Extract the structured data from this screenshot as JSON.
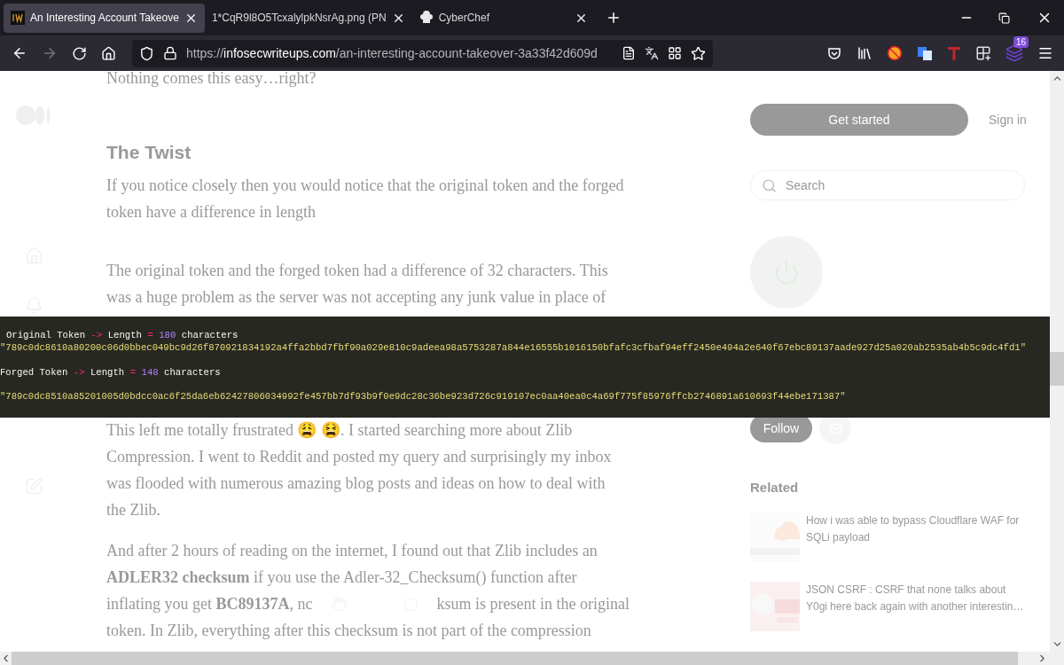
{
  "browser": {
    "tabs": [
      {
        "title": "An Interesting Account Takeove",
        "selected": true
      },
      {
        "title": "1*CqR9l8O5TcxalylpkNsrAg.png (PN",
        "selected": false
      },
      {
        "title": "CyberChef",
        "selected": false
      }
    ],
    "back": {
      "disabled": false
    },
    "forward": {
      "disabled": true
    },
    "address": {
      "scheme": "https://",
      "host": "infosecwriteups.com",
      "path": "/an-interesting-account-takeover-3a33f42d609d"
    },
    "extension_badge": "16"
  },
  "article": {
    "paragraphs": [
      {
        "kind": "text",
        "lines": [
          {
            "text": "Nothing comes this easy…right?"
          }
        ]
      },
      {
        "kind": "heading",
        "lines": [
          {
            "text": "The Twist"
          }
        ]
      },
      {
        "kind": "text",
        "lines": [
          {
            "text": "If you notice closely then you would notice that the original token and the forged"
          },
          {
            "text": "token have a difference in length"
          }
        ]
      },
      {
        "kind": "text",
        "lines": [
          {
            "text": "The original token and the forged token had a difference of 32 characters. This"
          },
          {
            "text": "was a huge problem as the server was not accepting any junk value in place of"
          }
        ]
      },
      {
        "kind": "text",
        "lines": [
          {
            "text": "This left me totally frustrated 😩 😫. I started searching more about Zlib"
          },
          {
            "text": "Compression. I went to Reddit and posted my query and surprisingly my inbox"
          },
          {
            "text": "was flooded with numerous amazing blog posts and ideas on how to deal with"
          },
          {
            "text": "the Zlib."
          }
        ]
      },
      {
        "kind": "text",
        "lines": [
          {
            "text": "And after 2 hours of reading on the internet, I found out that Zlib includes an"
          },
          {
            "text": "**ADLER32 checksum** if you use the Adler-32_Checksum() function after"
          },
          {
            "text": "inflating you get **BC89137A**, nc",
            "after": "ksum is present in the original"
          },
          {
            "text": "token. In Zlib, everything after this checksum is not part of the compression"
          }
        ]
      }
    ]
  },
  "sidebar": {
    "get_started": "Get started",
    "sign_in": "Sign in",
    "search": {
      "placeholder": "Search"
    },
    "follow": "Follow",
    "related_heading": "Related",
    "related": [
      {
        "title": "How i was able to bypass Cloudflare WAF for SQLi payload",
        "kind": "picture"
      },
      {
        "title": "JSON CSRF : CSRF that none talks about",
        "subtitle": "Y0gi here back again with another interestin…",
        "kind": "picture"
      }
    ]
  },
  "image_viewer": {
    "lines": [
      [
        {
          "kind": "label",
          "text": "Original Token"
        },
        {
          "kind": "operator",
          "text": "->"
        },
        {
          "kind": "label",
          "text": "Length"
        },
        {
          "kind": "operator",
          "text": "="
        },
        {
          "kind": "number",
          "text": "180"
        },
        {
          "kind": "label",
          "text": "characters"
        }
      ],
      [
        {
          "kind": "string",
          "text": "\"789c0dc8610a80200c06d0bbec049bc9d26f870921834192a4ffa2bbd7fbf90a029e810c9adeea98a5753287a844e16555b1016150bfafc3cfbaf94eff2450e494a2e640f67ebc89137aade927d25a020ab2535ab4b5c9dc4fd1\""
        }
      ],
      [
        {
          "kind": "label",
          "text": "Forged Token"
        },
        {
          "kind": "operator",
          "text": "->"
        },
        {
          "kind": "label",
          "text": "Length"
        },
        {
          "kind": "operator",
          "text": "="
        },
        {
          "kind": "number",
          "text": "148"
        },
        {
          "kind": "label",
          "text": "characters"
        }
      ],
      [
        {
          "kind": "string",
          "text": "\"789c0dc8510a85201005d0bdcc0ac6f25da6eb62427806034992fe457bb7df93b9f0e9dc28c36be923d726c919107ec0aa40ea0c4a69f775f85976ffcb2746891a610693f44ebe171387\""
        }
      ]
    ]
  }
}
